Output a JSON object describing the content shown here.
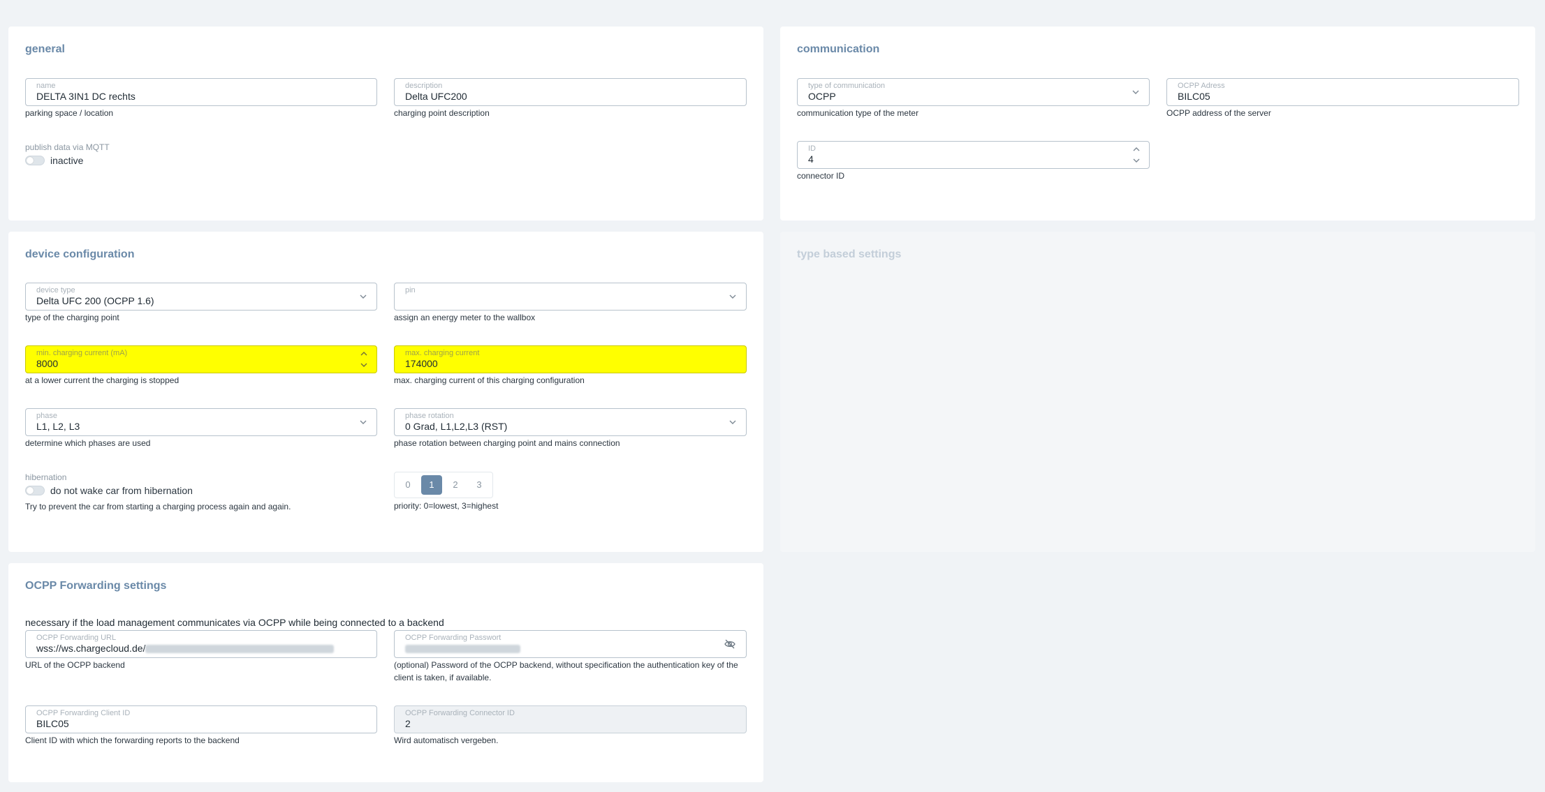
{
  "general": {
    "title": "general",
    "name": {
      "label": "name",
      "value": "DELTA 3IN1 DC rechts",
      "hint": "parking space / location"
    },
    "description": {
      "label": "description",
      "value": "Delta UFC200",
      "hint": "charging point description"
    },
    "mqtt": {
      "label": "publish data via MQTT",
      "state": "inactive"
    }
  },
  "communication": {
    "title": "communication",
    "type": {
      "label": "type of communication",
      "value": "OCPP",
      "hint": "communication type of the meter"
    },
    "ocpp_address": {
      "label": "OCPP Adress",
      "value": "BILC05",
      "hint": "OCPP address of the server"
    },
    "id": {
      "label": "ID",
      "value": "4",
      "hint": "connector ID"
    }
  },
  "device": {
    "title": "device configuration",
    "device_type": {
      "label": "device type",
      "value": "Delta UFC 200 (OCPP 1.6)",
      "hint": "type of the charging point"
    },
    "pin": {
      "label": "pin",
      "value": "",
      "hint": "assign an energy meter to the wallbox"
    },
    "min_current": {
      "label": "min. charging current (mA)",
      "value": "8000",
      "hint": "at a lower current the charging is stopped"
    },
    "max_current": {
      "label": "max. charging current",
      "value": "174000",
      "hint": "max. charging current of this charging configuration"
    },
    "phase": {
      "label": "phase",
      "value": "L1, L2, L3",
      "hint": "determine which phases are used"
    },
    "phase_rotation": {
      "label": "phase rotation",
      "value": "0 Grad, L1,L2,L3 (RST)",
      "hint": "phase rotation between charging point and mains connection"
    },
    "hibernation": {
      "label": "hibernation",
      "toggle_text": "do not wake car from hibernation",
      "hint": "Try to prevent the car from starting a charging process again and again."
    },
    "priority": {
      "options": [
        "0",
        "1",
        "2",
        "3"
      ],
      "selected": "1",
      "hint": "priority: 0=lowest, 3=highest"
    }
  },
  "type_based": {
    "title": "type based settings"
  },
  "forwarding": {
    "title": "OCPP Forwarding settings",
    "note": "necessary if the load management communicates via OCPP while being connected to a backend",
    "url": {
      "label": "OCPP Forwarding URL",
      "value": "wss://ws.chargecloud.de/",
      "hint": "URL of the OCPP backend"
    },
    "password": {
      "label": "OCPP Forwarding Passwort",
      "hint": "(optional) Password of the OCPP backend, without specification the authentication key of the client is taken, if available."
    },
    "client_id": {
      "label": "OCPP Forwarding Client ID",
      "value": "BILC05",
      "hint": "Client ID with which the forwarding reports to the backend"
    },
    "connector_id": {
      "label": "OCPP Forwarding Connector ID",
      "value": "2",
      "hint": "Wird automatisch vergeben."
    }
  },
  "colors": {
    "accent": "#6a89a8",
    "highlight": "#ffff00",
    "background": "#f0f3f6"
  },
  "icons": [
    "chevron-down-icon",
    "spinner-arrows-icon",
    "eye-off-icon"
  ]
}
